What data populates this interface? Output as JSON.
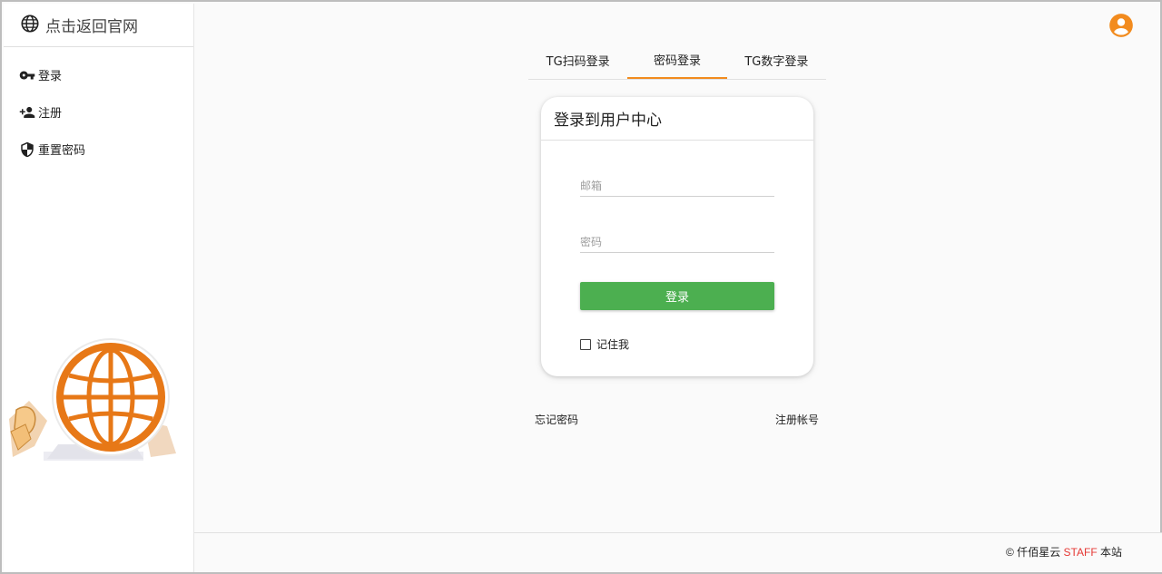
{
  "sidebar": {
    "brand": {
      "label": "点击返回官网",
      "icon": "globe-icon"
    },
    "items": [
      {
        "label": "登录",
        "icon": "key-icon"
      },
      {
        "label": "注册",
        "icon": "person-add-icon"
      },
      {
        "label": "重置密码",
        "icon": "shield-icon"
      }
    ],
    "mascot": {
      "icon": "globe-icon",
      "color": "#e77817"
    }
  },
  "header": {
    "avatar_icon": "account-circle-icon",
    "accent": "#f28b1e"
  },
  "tabs": [
    {
      "label": "TG扫码登录",
      "active": false
    },
    {
      "label": "密码登录",
      "active": true
    },
    {
      "label": "TG数字登录",
      "active": false
    }
  ],
  "card": {
    "title": "登录到用户中心",
    "email": {
      "placeholder": "邮箱",
      "value": ""
    },
    "password": {
      "placeholder": "密码",
      "value": ""
    },
    "login_button": "登录",
    "remember_me": {
      "label": "记住我",
      "checked": false
    },
    "button_color": "#4caf50"
  },
  "links": {
    "forgot": "忘记密码",
    "register": "注册帐号"
  },
  "footer": {
    "copyright": "©",
    "company": "仟佰星云",
    "staff": "STAFF",
    "suffix": "本站"
  }
}
